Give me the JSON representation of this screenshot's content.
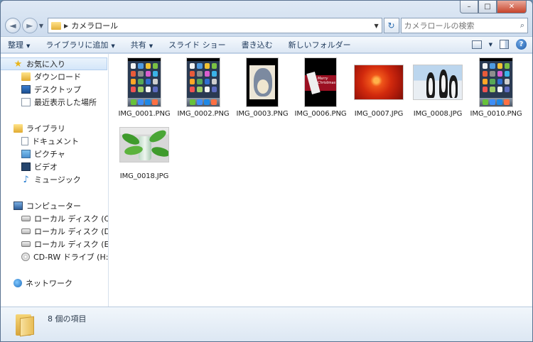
{
  "window": {
    "caption_minimize": "–",
    "caption_maximize": "□",
    "caption_close": "✕"
  },
  "address": {
    "back_glyph": "◄",
    "forward_glyph": "►",
    "path": "カメラロール",
    "refresh_glyph": "↻"
  },
  "search": {
    "placeholder": "カメラロールの検索",
    "icon_glyph": "⌕"
  },
  "toolbar": {
    "items": [
      {
        "label": "整理",
        "dropdown": true
      },
      {
        "label": "ライブラリに追加",
        "dropdown": true
      },
      {
        "label": "共有",
        "dropdown": true
      },
      {
        "label": "スライド ショー",
        "dropdown": false
      },
      {
        "label": "書き込む",
        "dropdown": false
      },
      {
        "label": "新しいフォルダー",
        "dropdown": false
      }
    ],
    "help_glyph": "?"
  },
  "nav": {
    "favorites": {
      "label": "お気に入り",
      "items": [
        "ダウンロード",
        "デスクトップ",
        "最近表示した場所"
      ]
    },
    "libraries": {
      "label": "ライブラリ",
      "items": [
        "ドキュメント",
        "ピクチャ",
        "ビデオ",
        "ミュージック"
      ]
    },
    "computer": {
      "label": "コンピューター",
      "items": [
        "ローカル ディスク (C:)",
        "ローカル ディスク (D:)",
        "ローカル ディスク (E:)",
        "CD-RW ドライブ (H:)"
      ]
    },
    "network": {
      "label": "ネットワーク"
    }
  },
  "files": [
    {
      "name": "IMG_0001.PNG",
      "thumb": "iphone-home"
    },
    {
      "name": "IMG_0002.PNG",
      "thumb": "iphone-home"
    },
    {
      "name": "IMG_0003.PNG",
      "thumb": "totoro"
    },
    {
      "name": "IMG_0006.PNG",
      "thumb": "card"
    },
    {
      "name": "IMG_0007.JPG",
      "thumb": "red-flower"
    },
    {
      "name": "IMG_0008.JPG",
      "thumb": "penguins"
    },
    {
      "name": "IMG_0010.PNG",
      "thumb": "iphone-home"
    },
    {
      "name": "IMG_0018.JPG",
      "thumb": "plant"
    }
  ],
  "card_text": "Merry\nChristmas",
  "status": {
    "item_count": "8 個の項目"
  }
}
